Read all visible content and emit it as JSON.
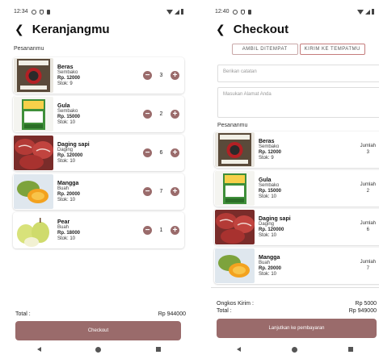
{
  "colors": {
    "accent": "#9a6b6b",
    "toggle_border": "#c9a8a8"
  },
  "cart_screen": {
    "status_time": "12:34",
    "title": "Keranjangmu",
    "section_label": "Pesananmu",
    "items": [
      {
        "name": "Beras",
        "category": "Sembako",
        "price": "Rp. 12000",
        "stock": "Stok: 9",
        "qty": "3",
        "image": "rice-bag-image"
      },
      {
        "name": "Gula",
        "category": "Sembako",
        "price": "Rp. 15000",
        "stock": "Stok: 10",
        "qty": "2",
        "image": "sugar-pack-image"
      },
      {
        "name": "Daging sapi",
        "category": "Daging",
        "price": "Rp. 120000",
        "stock": "Stok: 10",
        "qty": "6",
        "image": "beef-image"
      },
      {
        "name": "Mangga",
        "category": "Buah",
        "price": "Rp. 20000",
        "stock": "Stok: 10",
        "qty": "7",
        "image": "mango-image"
      },
      {
        "name": "Pear",
        "category": "Buah",
        "price": "Rp. 18000",
        "stock": "Stok: 10",
        "qty": "1",
        "image": "pear-image"
      }
    ],
    "minus_symbol": "−",
    "plus_symbol": "+",
    "total_label": "Total :",
    "total_value": "Rp 944000",
    "checkout_label": "Checkout"
  },
  "checkout_screen": {
    "status_time": "12:40",
    "title": "Checkout",
    "toggle": {
      "pickup": "AMBIL DITEMPAT",
      "delivery": "KIRIM KE TEMPATMU"
    },
    "note_placeholder": "Berikan catatan",
    "address_placeholder": "Masukan Alamat Anda",
    "section_label": "Pesananmu",
    "jumlah_label": "Jumlah",
    "items": [
      {
        "name": "Beras",
        "category": "Sembako",
        "price": "Rp. 12000",
        "stock": "Stok: 9",
        "qty": "3"
      },
      {
        "name": "Gula",
        "category": "Sembako",
        "price": "Rp. 15000",
        "stock": "Stok: 10",
        "qty": "2"
      },
      {
        "name": "Daging sapi",
        "category": "Daging",
        "price": "Rp. 120000",
        "stock": "Stok: 10",
        "qty": "6"
      },
      {
        "name": "Mangga",
        "category": "Buah",
        "price": "Rp. 20000",
        "stock": "Stok: 10",
        "qty": "7"
      }
    ],
    "shipping_label": "Ongkos Kirim :",
    "shipping_value": "Rp 5000",
    "total_label": "Total :",
    "total_value": "Rp 949000",
    "continue_label": "Lanjutkan ke pembayaran"
  }
}
